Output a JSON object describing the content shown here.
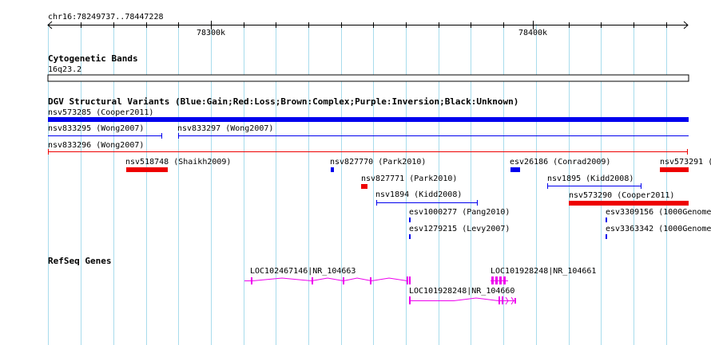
{
  "ruler": {
    "location": "chr16:78249737..78447228",
    "ticks": [
      "78300k",
      "78400k"
    ]
  },
  "cytoband": {
    "title": "Cytogenetic Bands",
    "band": "16q23.2"
  },
  "dgv": {
    "title": "DGV Structural Variants (Blue:Gain;Red:Loss;Brown:Complex;Purple:Inversion;Black:Unknown)",
    "colors": {
      "gain": "#0000ee",
      "loss": "#ee0000"
    },
    "features": [
      {
        "label": "nsv573285 (Cooper2011)",
        "type": "gain",
        "style": "thick"
      },
      {
        "label": "nsv833295 (Wong2007)",
        "type": "gain",
        "style": "thin"
      },
      {
        "label": "nsv833297 (Wong2007)",
        "type": "gain",
        "style": "thin"
      },
      {
        "label": "nsv833296 (Wong2007)",
        "type": "loss",
        "style": "thin"
      },
      {
        "label": "nsv518748 (Shaikh2009)",
        "type": "loss",
        "style": "thick"
      },
      {
        "label": "nsv827770 (Park2010)",
        "type": "gain",
        "style": "thick"
      },
      {
        "label": "esv26186 (Conrad2009)",
        "type": "gain",
        "style": "thick"
      },
      {
        "label": "nsv573291 (C",
        "type": "loss",
        "style": "thick"
      },
      {
        "label": "nsv827771 (Park2010)",
        "type": "loss",
        "style": "thick"
      },
      {
        "label": "nsv1895 (Kidd2008)",
        "type": "gain",
        "style": "thin"
      },
      {
        "label": "nsv1894 (Kidd2008)",
        "type": "gain",
        "style": "thin"
      },
      {
        "label": "nsv573290 (Cooper2011)",
        "type": "loss",
        "style": "thick"
      },
      {
        "label": "esv1000277 (Pang2010)",
        "type": "gain",
        "style": "thick"
      },
      {
        "label": "esv3309156 (1000Genome",
        "type": "gain",
        "style": "thick"
      },
      {
        "label": "esv1279215 (Levy2007)",
        "type": "gain",
        "style": "thick"
      },
      {
        "label": "esv3363342 (1000Genome",
        "type": "gain",
        "style": "thick"
      }
    ]
  },
  "refseq": {
    "title": "RefSeq Genes",
    "color": "#ee00ee",
    "genes": [
      {
        "label": "LOC102467146|NR_104663"
      },
      {
        "label": "LOC101928248|NR_104661"
      },
      {
        "label": "LOC101928248|NR_104660"
      }
    ]
  }
}
